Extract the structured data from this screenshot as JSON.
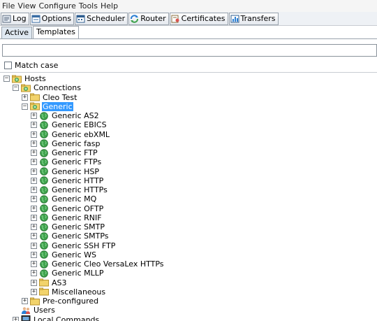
{
  "menubar": [
    "File",
    "View",
    "Configure",
    "Tools",
    "Help"
  ],
  "toolbar": [
    {
      "label": "Log",
      "icon": "log-icon"
    },
    {
      "label": "Options",
      "icon": "options-icon"
    },
    {
      "label": "Scheduler",
      "icon": "scheduler-icon"
    },
    {
      "label": "Router",
      "icon": "router-icon"
    },
    {
      "label": "Certificates",
      "icon": "certificates-icon"
    },
    {
      "label": "Transfers",
      "icon": "transfers-icon"
    }
  ],
  "tabs": [
    {
      "label": "Active",
      "active": false
    },
    {
      "label": "Templates",
      "active": true
    }
  ],
  "search": {
    "value": "",
    "placeholder": ""
  },
  "match_case": {
    "label": "Match case",
    "checked": false
  },
  "tree": [
    {
      "label": "Hosts",
      "depth": 0,
      "icon": "hosts",
      "expander": "minus"
    },
    {
      "label": "Connections",
      "depth": 1,
      "icon": "hosts",
      "expander": "minus"
    },
    {
      "label": "Cleo Test",
      "depth": 2,
      "icon": "folder",
      "expander": "plus"
    },
    {
      "label": "Generic",
      "depth": 2,
      "icon": "hosts",
      "expander": "minus",
      "selected": true
    },
    {
      "label": "Generic AS2",
      "depth": 3,
      "icon": "globe",
      "expander": "plus"
    },
    {
      "label": "Generic EBICS",
      "depth": 3,
      "icon": "globe",
      "expander": "plus"
    },
    {
      "label": "Generic ebXML",
      "depth": 3,
      "icon": "globe",
      "expander": "plus"
    },
    {
      "label": "Generic fasp",
      "depth": 3,
      "icon": "globe",
      "expander": "plus"
    },
    {
      "label": "Generic FTP",
      "depth": 3,
      "icon": "globe",
      "expander": "plus"
    },
    {
      "label": "Generic FTPs",
      "depth": 3,
      "icon": "globe",
      "expander": "plus"
    },
    {
      "label": "Generic HSP",
      "depth": 3,
      "icon": "globe",
      "expander": "plus"
    },
    {
      "label": "Generic HTTP",
      "depth": 3,
      "icon": "globe",
      "expander": "plus"
    },
    {
      "label": "Generic HTTPs",
      "depth": 3,
      "icon": "globe",
      "expander": "plus"
    },
    {
      "label": "Generic MQ",
      "depth": 3,
      "icon": "globe",
      "expander": "plus"
    },
    {
      "label": "Generic OFTP",
      "depth": 3,
      "icon": "globe",
      "expander": "plus"
    },
    {
      "label": "Generic RNIF",
      "depth": 3,
      "icon": "globe",
      "expander": "plus"
    },
    {
      "label": "Generic SMTP",
      "depth": 3,
      "icon": "globe",
      "expander": "plus"
    },
    {
      "label": "Generic SMTPs",
      "depth": 3,
      "icon": "globe",
      "expander": "plus"
    },
    {
      "label": "Generic SSH FTP",
      "depth": 3,
      "icon": "globe",
      "expander": "plus"
    },
    {
      "label": "Generic WS",
      "depth": 3,
      "icon": "globe",
      "expander": "plus"
    },
    {
      "label": "Generic Cleo VersaLex HTTPs",
      "depth": 3,
      "icon": "globe",
      "expander": "plus"
    },
    {
      "label": "Generic MLLP",
      "depth": 3,
      "icon": "globe",
      "expander": "plus"
    },
    {
      "label": "AS3",
      "depth": 3,
      "icon": "folder",
      "expander": "plus"
    },
    {
      "label": "Miscellaneous",
      "depth": 3,
      "icon": "folder",
      "expander": "plus"
    },
    {
      "label": "Pre-configured",
      "depth": 2,
      "icon": "folder",
      "expander": "plus"
    },
    {
      "label": "Users",
      "depth": 1,
      "icon": "users",
      "expander": "none"
    },
    {
      "label": "Local Commands",
      "depth": 1,
      "icon": "computer",
      "expander": "plus"
    }
  ],
  "colors": {
    "selection": "#3399ff",
    "folder": "#f2d36b",
    "globe": "#3fa34d"
  }
}
